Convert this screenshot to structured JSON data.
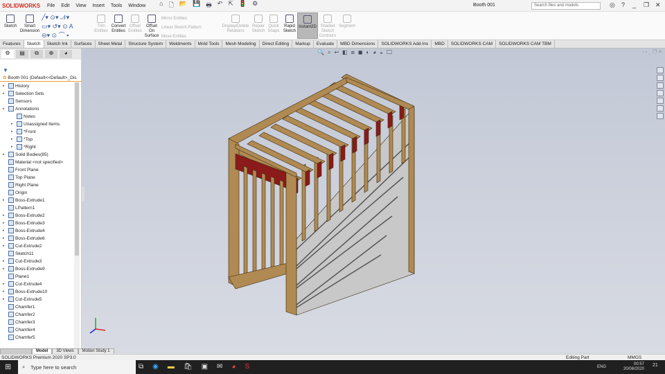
{
  "app": {
    "brand": "SOLIDWORKS",
    "document_title": "Booth 001",
    "search_placeholder": "Search files and models"
  },
  "menu": [
    "File",
    "Edit",
    "View",
    "Insert",
    "Tools",
    "Window"
  ],
  "ribbon": {
    "sketch": "Sketch",
    "smart_dimension": "Smart Dimension",
    "trim": "Trim Entities",
    "convert": "Convert Entities",
    "offset": "Offset Entities",
    "offset_surface": "Offset On Surface",
    "mirror": "Mirror Entities",
    "linear_pattern": "Linear Sketch Pattern",
    "move": "Move Entities",
    "display_delete": "Display/Delete Relations",
    "repair": "Repair Sketch",
    "quick_snaps": "Quick Snaps",
    "rapid_sketch": "Rapid Sketch",
    "instant2d": "Instant2D",
    "shaded": "Shaded Sketch Contours",
    "segment": "Segment"
  },
  "tabs": [
    "Features",
    "Sketch",
    "Sketch Ink",
    "Surfaces",
    "Sheet Metal",
    "Structure System",
    "Weldments",
    "Mold Tools",
    "Mesh Modeling",
    "Direct Editing",
    "Markup",
    "Evaluate",
    "MBD Dimensions",
    "SOLIDWORKS Add-Ins",
    "MBD",
    "SOLIDWORKS CAM",
    "SOLIDWORKS CAM TBM"
  ],
  "active_tab": "Sketch",
  "tree": {
    "root": "Booth 001  (Default<<Default>_Dis",
    "items": [
      {
        "label": "History",
        "exp": true,
        "indent": 0
      },
      {
        "label": "Selection Sets",
        "exp": true,
        "indent": 0
      },
      {
        "label": "Sensors",
        "exp": false,
        "indent": 0
      },
      {
        "label": "Annotations",
        "exp": true,
        "indent": 0
      },
      {
        "label": "Notes",
        "exp": false,
        "indent": 1
      },
      {
        "label": "Unassigned Items",
        "exp": true,
        "indent": 1
      },
      {
        "label": "*Front",
        "exp": true,
        "indent": 1
      },
      {
        "label": "*Top",
        "exp": true,
        "indent": 1
      },
      {
        "label": "*Right",
        "exp": true,
        "indent": 1
      },
      {
        "label": "Solid Bodies(85)",
        "exp": true,
        "indent": 0
      },
      {
        "label": "Material <not specified>",
        "exp": false,
        "indent": 0
      },
      {
        "label": "Front Plane",
        "exp": false,
        "indent": 0
      },
      {
        "label": "Top Plane",
        "exp": false,
        "indent": 0
      },
      {
        "label": "Right Plane",
        "exp": false,
        "indent": 0
      },
      {
        "label": "Origin",
        "exp": false,
        "indent": 0
      },
      {
        "label": "Boss-Extrude1",
        "exp": true,
        "indent": 0
      },
      {
        "label": "LPattern1",
        "exp": false,
        "indent": 0
      },
      {
        "label": "Boss-Extrude2",
        "exp": true,
        "indent": 0
      },
      {
        "label": "Boss-Extrude3",
        "exp": true,
        "indent": 0
      },
      {
        "label": "Boss-Extrude4",
        "exp": true,
        "indent": 0
      },
      {
        "label": "Boss-Extrude6",
        "exp": true,
        "indent": 0
      },
      {
        "label": "Cut-Extrude2",
        "exp": true,
        "indent": 0
      },
      {
        "label": "Sketch11",
        "exp": false,
        "indent": 0
      },
      {
        "label": "Cut-Extrude3",
        "exp": true,
        "indent": 0
      },
      {
        "label": "Boss-Extrude9",
        "exp": true,
        "indent": 0
      },
      {
        "label": "Plane1",
        "exp": false,
        "indent": 0
      },
      {
        "label": "Cut-Extrude4",
        "exp": true,
        "indent": 0
      },
      {
        "label": "Boss-Extrude10",
        "exp": true,
        "indent": 0
      },
      {
        "label": "Cut-Extrude5",
        "exp": true,
        "indent": 0
      },
      {
        "label": "Chamfer1",
        "exp": false,
        "indent": 0
      },
      {
        "label": "Chamfer2",
        "exp": false,
        "indent": 0
      },
      {
        "label": "Chamfer3",
        "exp": false,
        "indent": 0
      },
      {
        "label": "Chamfer4",
        "exp": false,
        "indent": 0
      },
      {
        "label": "Chamfer5",
        "exp": false,
        "indent": 0
      }
    ]
  },
  "bottom_tabs": [
    "Model",
    "3D Views",
    "Motion Study 1"
  ],
  "status": {
    "version": "SOLIDWORKS Premium 2020 SP3.0",
    "mode": "Editing Part",
    "units": "MMGS"
  },
  "taskbar": {
    "search": "Type here to search",
    "lang": "ENG",
    "time": "00:57",
    "date": "20/08/2020",
    "notifications": "21"
  },
  "colors": {
    "wood": "#b08a52",
    "red_beam": "#8b1a1a",
    "panel": "#c8c8c8",
    "viewport": "#c8ccd6",
    "brand": "#d52b1e"
  }
}
